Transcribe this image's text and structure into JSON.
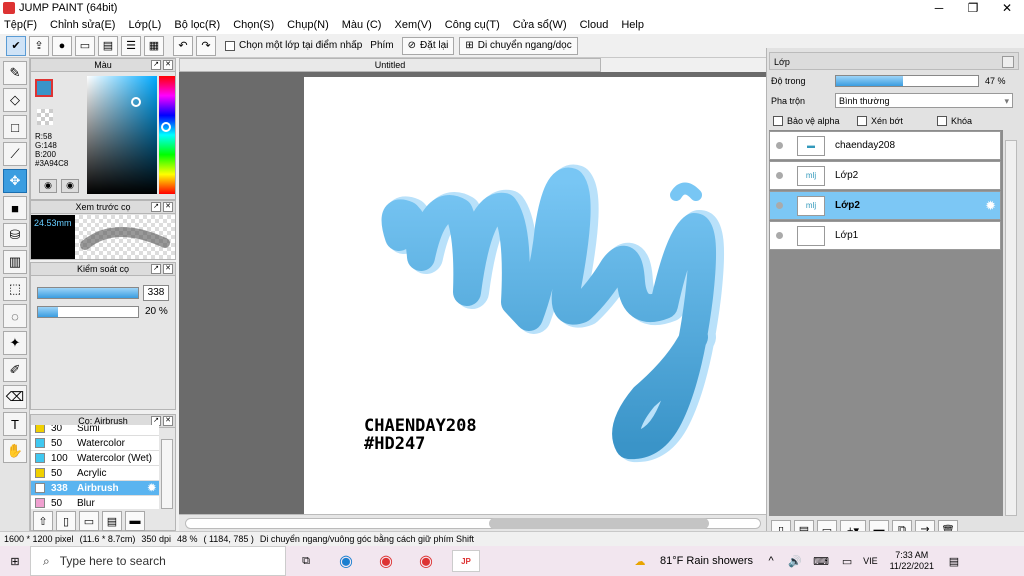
{
  "window": {
    "title": "JUMP PAINT (64bit)"
  },
  "menu": [
    "Tệp(F)",
    "Chỉnh sửa(E)",
    "Lớp(L)",
    "Bộ lọc(R)",
    "Chọn(S)",
    "Chụp(N)",
    "Màu (C)",
    "Xem(V)",
    "Công cụ(T)",
    "Cửa sổ(W)",
    "Cloud",
    "Help"
  ],
  "toolbar": {
    "select_layer_label": "Chọn một lớp tại điểm nhấp",
    "shortcut_label": "Phím",
    "reset_label": "Đặt lại",
    "move_label": "Di chuyển ngang/dọc"
  },
  "color_panel": {
    "title": "Màu",
    "r": "R:58",
    "g": "G:148",
    "b": "B:200",
    "hex": "#3A94C8",
    "color": "#3A94C8"
  },
  "brush_preview": {
    "title": "Xem trước cọ",
    "size": "24.53mm"
  },
  "brush_control": {
    "title": "Kiểm soát cọ",
    "size_value": "338",
    "opacity_value": "20 %"
  },
  "brush_list": {
    "title": "Cọ: Airbrush",
    "items": [
      {
        "value": "30",
        "name": "Sumi",
        "color": "#f0d000"
      },
      {
        "value": "50",
        "name": "Watercolor",
        "color": "#40c8f0"
      },
      {
        "value": "100",
        "name": "Watercolor (Wet)",
        "color": "#40c8f0"
      },
      {
        "value": "50",
        "name": "Acrylic",
        "color": "#f0d000"
      },
      {
        "value": "338",
        "name": "Airbrush",
        "color": "#ffffff"
      },
      {
        "value": "50",
        "name": "Blur",
        "color": "#f0a0d0"
      }
    ]
  },
  "document": {
    "tab": "Untitled",
    "watermark_line1": "CHAENDAY208",
    "watermark_line2": "#HD247",
    "lettering": "mlj"
  },
  "layer_panel": {
    "title": "Lớp",
    "opacity_label": "Độ trong",
    "opacity_value": "47 %",
    "opacity": 0.47,
    "blend_label": "Pha trộn",
    "blend_value": "Bình thường",
    "protect_alpha": "Bảo vệ alpha",
    "clipping": "Xén bớt",
    "lock": "Khóa",
    "layers": [
      {
        "name": "chaenday208"
      },
      {
        "name": "Lớp2"
      },
      {
        "name": "Lớp2"
      },
      {
        "name": "Lớp1"
      }
    ]
  },
  "status": {
    "size": "1600 * 1200 pixel",
    "cm": "(11.6 * 8.7cm)",
    "dpi": "350 dpi",
    "zoom": "48 %",
    "coord": "( 1184, 785 )",
    "hint": "Di chuyển ngang/vuông góc bằng cách giữ phím Shift"
  },
  "taskbar": {
    "search_placeholder": "Type here to search",
    "weather": "81°F  Rain showers",
    "lang": "VIE",
    "time": "7:33 AM",
    "date": "11/22/2021"
  }
}
